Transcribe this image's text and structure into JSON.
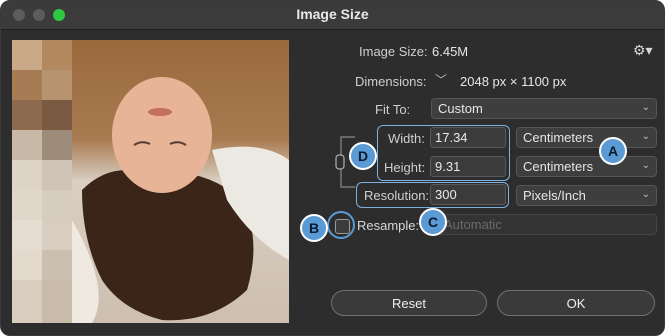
{
  "window": {
    "title": "Image Size"
  },
  "info": {
    "image_size_label": "Image Size:",
    "image_size_value": "6.45M",
    "dimensions_label": "Dimensions:",
    "dimensions_value": "2048 px  ×  1100 px"
  },
  "fit_to": {
    "label": "Fit To:",
    "value": "Custom"
  },
  "width": {
    "label": "Width:",
    "value": "17.34",
    "unit": "Centimeters"
  },
  "height": {
    "label": "Height:",
    "value": "9.31",
    "unit": "Centimeters"
  },
  "resolution": {
    "label": "Resolution:",
    "value": "300",
    "unit": "Pixels/Inch"
  },
  "resample": {
    "label": "Resample:",
    "checked": false,
    "method": "Automatic"
  },
  "annotations": {
    "a": "A",
    "b": "B",
    "c": "C",
    "d": "D"
  },
  "buttons": {
    "reset": "Reset",
    "ok": "OK"
  },
  "icons": {
    "gear": "gear-icon",
    "link": "link-chain-icon",
    "dimension_chevron": "chevron-down-icon"
  },
  "colors": {
    "annotation_badge": "#5a9bd5",
    "highlight_border": "#7fb1e0",
    "zoom_button": "#2ec942"
  }
}
